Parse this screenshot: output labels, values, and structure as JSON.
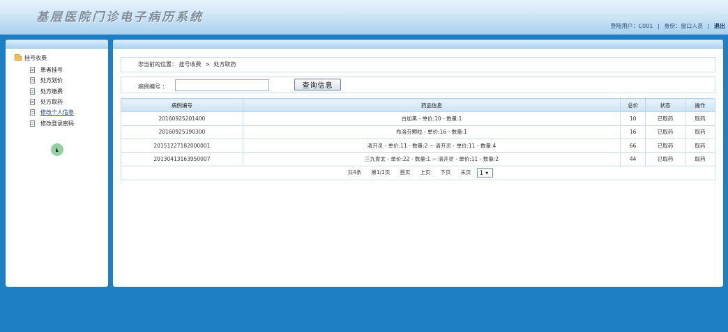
{
  "header": {
    "title": "基层医院门诊电子病历系统",
    "user_label": "登陆用户：C001",
    "role_label": "身份：窗口人员",
    "separator": "|",
    "logout_label": "退出"
  },
  "sidebar": {
    "root_label": "挂号收费",
    "items": [
      {
        "label": "患者挂号"
      },
      {
        "label": "处方划价"
      },
      {
        "label": "处方缴费"
      },
      {
        "label": "处方取药"
      },
      {
        "label": "修改个人信息"
      },
      {
        "label": "修改登录密码"
      }
    ]
  },
  "main": {
    "breadcrumb": {
      "prefix": "您当前的位置：",
      "level1": "挂号收费",
      "separator": ">",
      "level2": "处方取药"
    },
    "search": {
      "label": "病例编号 ：",
      "value": "",
      "button_label": "查询信息"
    },
    "table": {
      "headers": [
        "病例编号",
        "药品信息",
        "总价",
        "状态",
        "操作"
      ],
      "rows": [
        {
          "id": "20160925201400",
          "drugs": "白加黑 - 单价:10 - 数量:1",
          "total": "10",
          "status": "已取药",
          "action": "取药"
        },
        {
          "id": "20160925190300",
          "drugs": "布洛芬颗粒 - 单价:16 - 数量:1",
          "total": "16",
          "status": "已取药",
          "action": "取药"
        },
        {
          "id": "20151227182000001",
          "drugs": "清开灵 - 单价:11 - 数量:2 ~ 清开灵 - 单价:11 - 数量:4",
          "total": "66",
          "status": "已取药",
          "action": "取药"
        },
        {
          "id": "20130413163950007",
          "drugs": "三九胃太 - 单价:22 - 数量:1 ~ 清开灵 - 单价:11 - 数量:2",
          "total": "44",
          "status": "已取药",
          "action": "取药"
        }
      ]
    },
    "pager": {
      "total": "共4条",
      "page_info": "第1/1页",
      "first": "首页",
      "prev": "上页",
      "next": "下页",
      "last": "末页",
      "page_select": "1"
    }
  }
}
